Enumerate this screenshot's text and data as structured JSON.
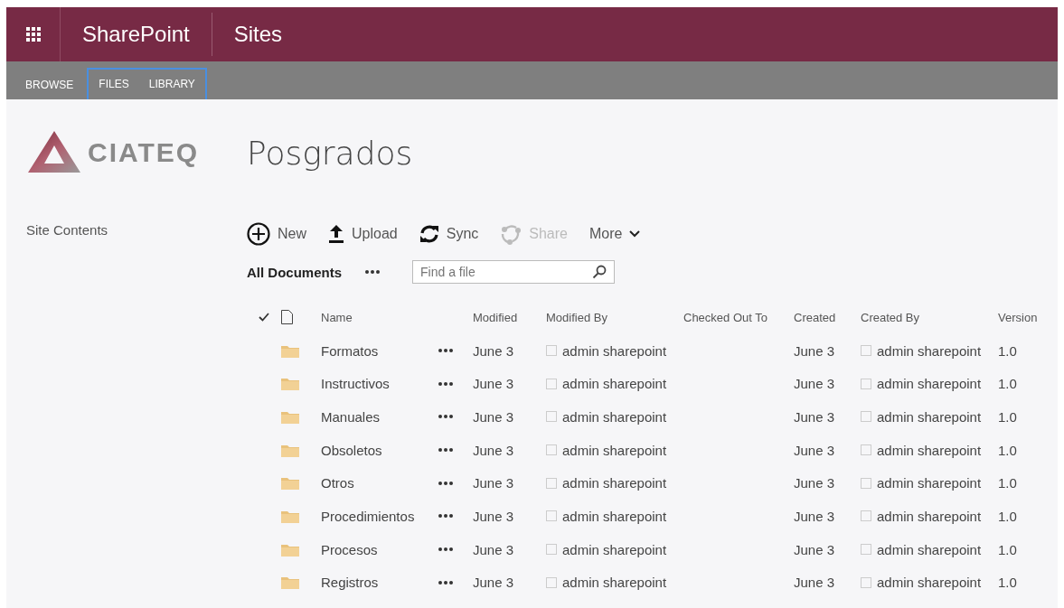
{
  "suite_bar": {
    "app_name": "SharePoint",
    "section": "Sites"
  },
  "ribbon": {
    "tabs": [
      {
        "label": "BROWSE",
        "contextual": false
      },
      {
        "label": "FILES",
        "contextual": true
      },
      {
        "label": "LIBRARY",
        "contextual": true
      }
    ]
  },
  "site": {
    "logo_text": "CIATEQ",
    "title": "Posgrados"
  },
  "sidebar": {
    "items": [
      "Site Contents"
    ]
  },
  "toolbar": {
    "actions": [
      {
        "label": "New",
        "kind": "new",
        "disabled": false
      },
      {
        "label": "Upload",
        "kind": "upload",
        "disabled": false
      },
      {
        "label": "Sync",
        "kind": "sync",
        "disabled": false
      },
      {
        "label": "Share",
        "kind": "share",
        "disabled": true
      },
      {
        "label": "More",
        "kind": "more",
        "disabled": false
      }
    ]
  },
  "view": {
    "name": "All Documents",
    "search": {
      "placeholder": "Find a file"
    }
  },
  "table": {
    "columns": [
      "Name",
      "Modified",
      "Modified By",
      "Checked Out To",
      "Created",
      "Created By",
      "Version"
    ],
    "rows": [
      {
        "name": "Formatos",
        "modified": "June 3",
        "modified_by": "admin sharepoint",
        "created": "June 3",
        "created_by": "admin sharepoint",
        "version": "1.0"
      },
      {
        "name": "Instructivos",
        "modified": "June 3",
        "modified_by": "admin sharepoint",
        "created": "June 3",
        "created_by": "admin sharepoint",
        "version": "1.0"
      },
      {
        "name": "Manuales",
        "modified": "June 3",
        "modified_by": "admin sharepoint",
        "created": "June 3",
        "created_by": "admin sharepoint",
        "version": "1.0"
      },
      {
        "name": "Obsoletos",
        "modified": "June 3",
        "modified_by": "admin sharepoint",
        "created": "June 3",
        "created_by": "admin sharepoint",
        "version": "1.0"
      },
      {
        "name": "Otros",
        "modified": "June 3",
        "modified_by": "admin sharepoint",
        "created": "June 3",
        "created_by": "admin sharepoint",
        "version": "1.0"
      },
      {
        "name": "Procedimientos",
        "modified": "June 3",
        "modified_by": "admin sharepoint",
        "created": "June 3",
        "created_by": "admin sharepoint",
        "version": "1.0"
      },
      {
        "name": "Procesos",
        "modified": "June 3",
        "modified_by": "admin sharepoint",
        "created": "June 3",
        "created_by": "admin sharepoint",
        "version": "1.0"
      },
      {
        "name": "Registros",
        "modified": "June 3",
        "modified_by": "admin sharepoint",
        "created": "June 3",
        "created_by": "admin sharepoint",
        "version": "1.0"
      }
    ]
  }
}
